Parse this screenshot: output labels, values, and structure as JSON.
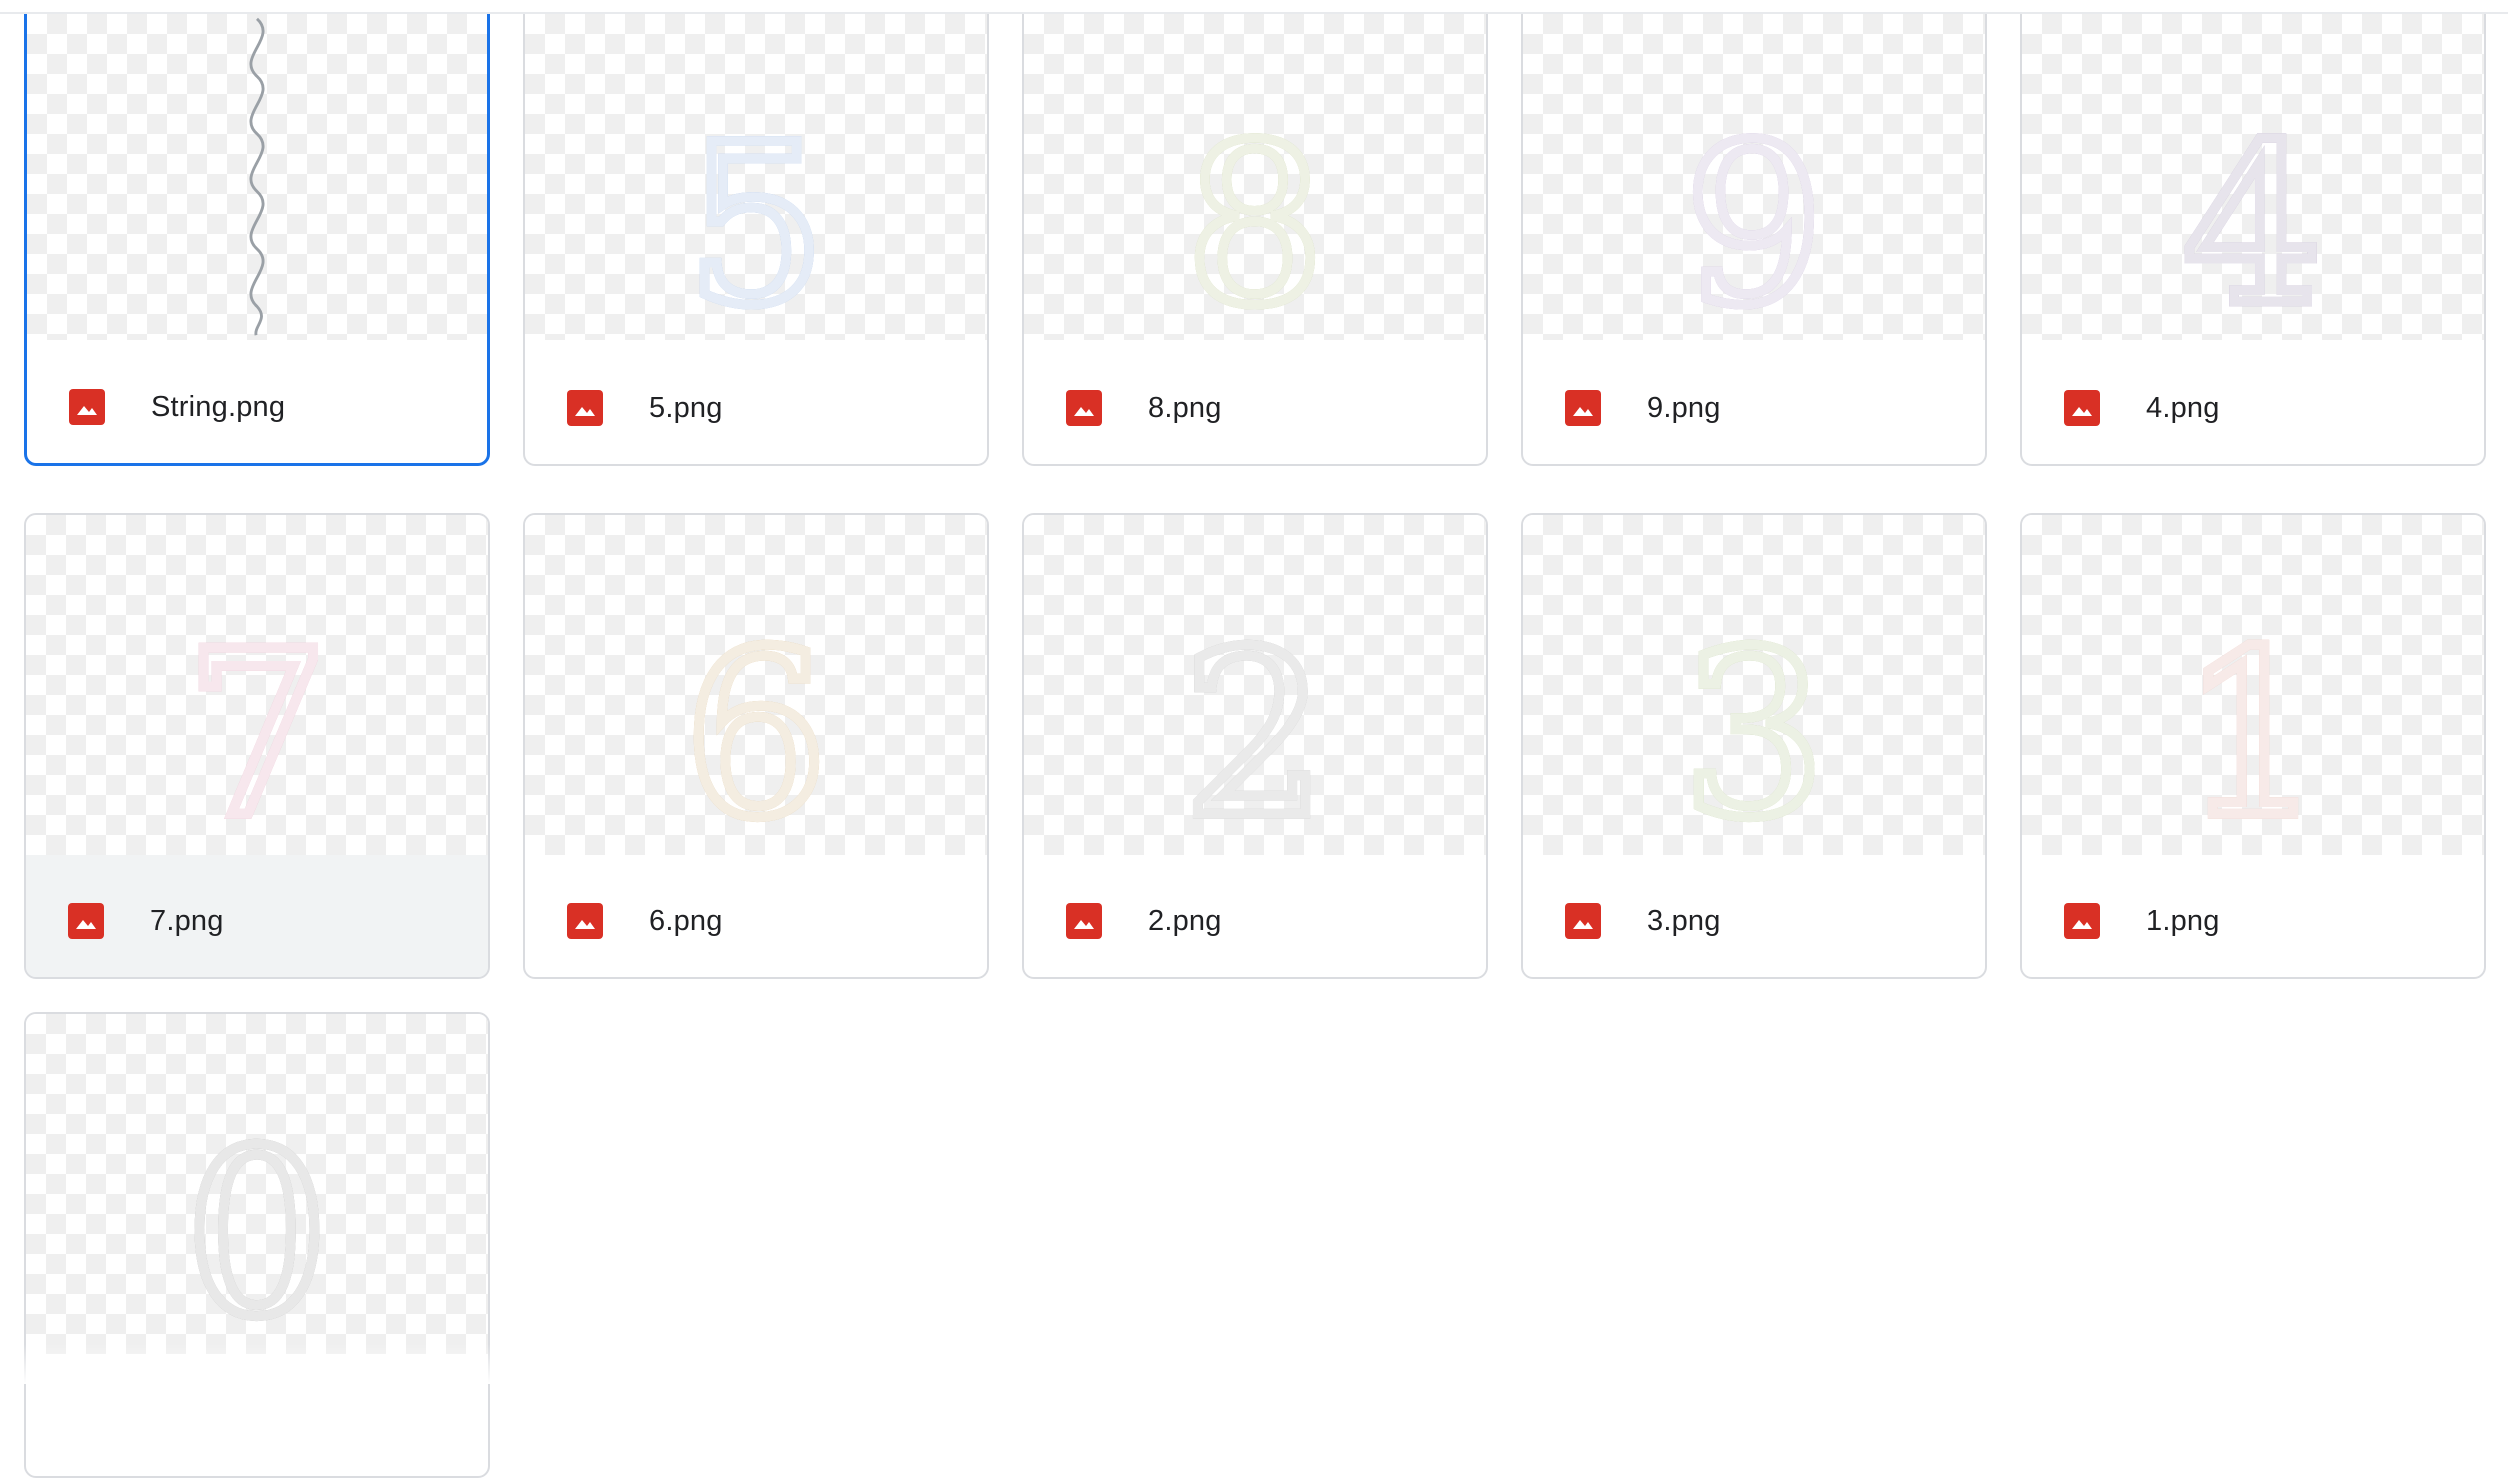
{
  "files": [
    {
      "name": "String.png",
      "kind": "string",
      "digit": "",
      "color": "#9aa0a6",
      "selected": true
    },
    {
      "name": "5.png",
      "kind": "digit",
      "digit": "5",
      "color": "#7ea2d8"
    },
    {
      "name": "8.png",
      "kind": "digit",
      "digit": "8",
      "color": "#aab97a"
    },
    {
      "name": "9.png",
      "kind": "digit",
      "digit": "9",
      "color": "#a892c0"
    },
    {
      "name": "4.png",
      "kind": "digit",
      "digit": "4",
      "color": "#8b7aa3"
    },
    {
      "name": "7.png",
      "kind": "digit",
      "digit": "7",
      "color": "#d78aa6",
      "hover": true
    },
    {
      "name": "6.png",
      "kind": "digit",
      "digit": "6",
      "color": "#c9a56a"
    },
    {
      "name": "2.png",
      "kind": "digit",
      "digit": "2",
      "color": "#9a9a9a"
    },
    {
      "name": "3.png",
      "kind": "digit",
      "digit": "3",
      "color": "#a4bb7c"
    },
    {
      "name": "1.png",
      "kind": "digit",
      "digit": "1",
      "color": "#d99a8e"
    },
    {
      "name": "",
      "kind": "digit",
      "digit": "0",
      "color": "#8f8f8f"
    }
  ],
  "file_type_icon": "image-file-icon"
}
